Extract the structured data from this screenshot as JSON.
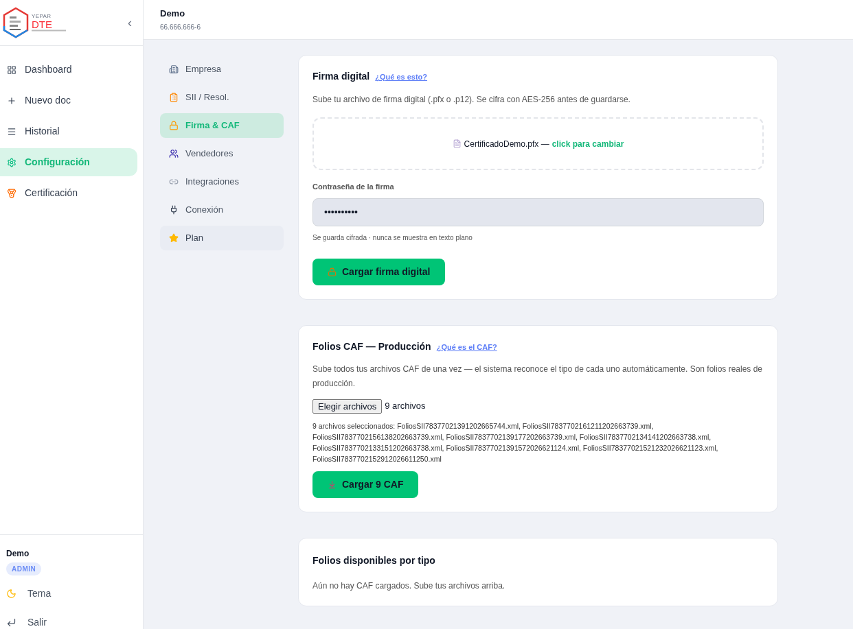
{
  "brand": {
    "top": "YEPAR",
    "name": "DTE"
  },
  "sidebar": {
    "collapse": "‹",
    "items": [
      {
        "label": "Dashboard",
        "selected": false
      },
      {
        "label": "Nuevo doc",
        "selected": false
      },
      {
        "label": "Historial",
        "selected": false
      },
      {
        "label": "Configuración",
        "selected": true
      },
      {
        "label": "Certificación",
        "selected": false
      }
    ],
    "user": {
      "name": "Demo",
      "role": "ADMIN"
    },
    "footer": [
      {
        "label": "Tema"
      },
      {
        "label": "Salir"
      }
    ]
  },
  "header": {
    "company": "Demo",
    "rut": "66.666.666-6"
  },
  "subnav": [
    {
      "label": "Empresa",
      "selected": false,
      "hovered": false
    },
    {
      "label": "SII / Resol.",
      "selected": false,
      "hovered": false
    },
    {
      "label": "Firma & CAF",
      "selected": true,
      "hovered": false
    },
    {
      "label": "Vendedores",
      "selected": false,
      "hovered": false
    },
    {
      "label": "Integraciones",
      "selected": false,
      "hovered": false
    },
    {
      "label": "Conexión",
      "selected": false,
      "hovered": false
    },
    {
      "label": "Plan",
      "selected": false,
      "hovered": true
    }
  ],
  "firma": {
    "title": "Firma digital",
    "help": "¿Qué es esto?",
    "description": "Sube tu archivo de firma digital (.pfx o .p12). Se cifra con AES-256 antes de guardarse.",
    "file": "CertificadoDemo.pfx —",
    "change": "click para cambiar",
    "password_label": "Contraseña de la firma",
    "password": "••••••••••",
    "hint": "Se guarda cifrada · nunca se muestra en texto plano",
    "button": "Cargar firma digital"
  },
  "caf": {
    "title": "Folios CAF — Producción",
    "help": "¿Qué es el CAF?",
    "description": "Sube todos tus archivos CAF de una vez — el sistema reconoce el tipo de cada uno automáticamente. Son folios reales de producción.",
    "choose": "Elegir archivos",
    "count": "9 archivos",
    "selected_files": "9 archivos seleccionados: FoliosSII78377021391202665744.xml, FoliosSII7837702161211202663739.xml, FoliosSII7837702156138202663739.xml, FoliosSII7837702139177202663739.xml, FoliosSII7837702134141202663738.xml, FoliosSII7837702133151202663738.xml, FoliosSII78377021391572026621124.xml, FoliosSII78377021521232026621123.xml, FoliosSII7837702152912026611250.xml",
    "button": "Cargar 9 CAF"
  },
  "available": {
    "title": "Folios disponibles por tipo",
    "empty": "Aún no hay CAF cargados. Sube tus archivos arriba."
  }
}
